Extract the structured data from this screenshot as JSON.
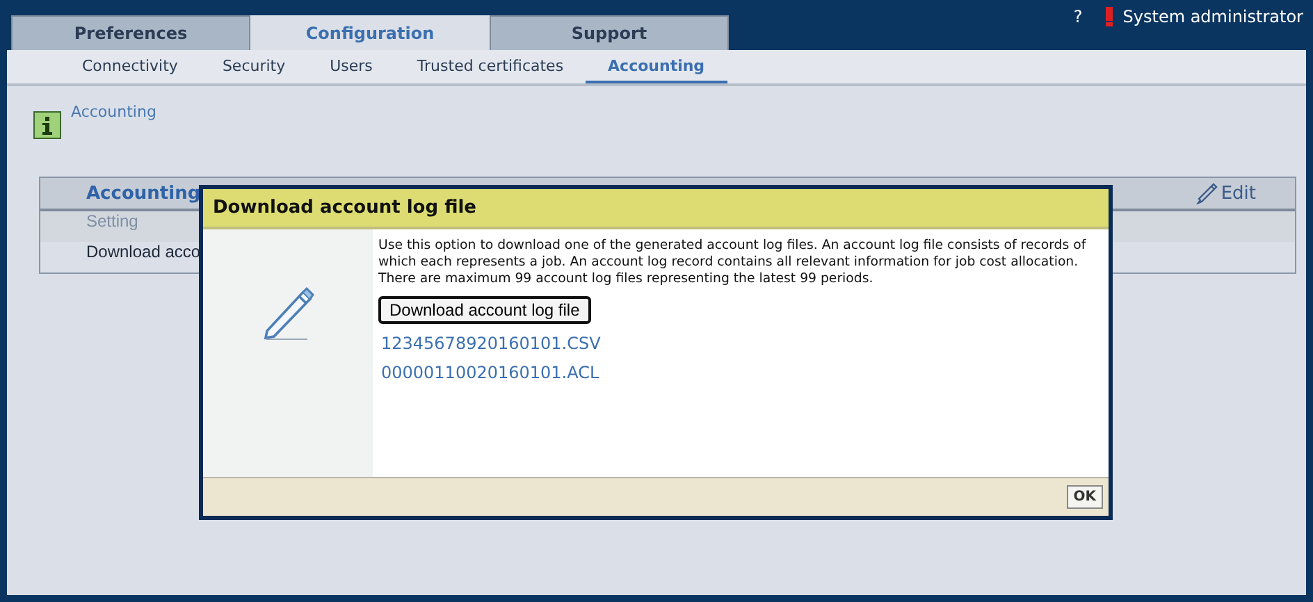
{
  "main_tabs": [
    {
      "label": "Preferences",
      "selected": false
    },
    {
      "label": "Configuration",
      "selected": true
    },
    {
      "label": "Support",
      "selected": false
    }
  ],
  "help": "?",
  "user": "System administrator",
  "sub_tabs": [
    {
      "label": "Connectivity",
      "selected": false
    },
    {
      "label": "Security",
      "selected": false
    },
    {
      "label": "Users",
      "selected": false
    },
    {
      "label": "Trusted certificates",
      "selected": false
    },
    {
      "label": "Accounting",
      "selected": true
    }
  ],
  "breadcrumb": "Accounting",
  "panel": {
    "title": "Accounting",
    "edit": "Edit",
    "rows": [
      {
        "label": "Setting",
        "kind": "header"
      },
      {
        "label": "Download acco",
        "kind": "item"
      }
    ]
  },
  "dialog": {
    "title": "Download account log file",
    "description": "Use this option to download one of the generated account log files. An account log file consists of records of which each represents a job. An account log record contains all relevant information for job cost allocation. There are maximum 99 account log files representing the latest 99 periods.",
    "button": "Download account log file",
    "files": [
      "12345678920160101.CSV",
      "00000110020160101.ACL"
    ],
    "ok": "OK"
  }
}
